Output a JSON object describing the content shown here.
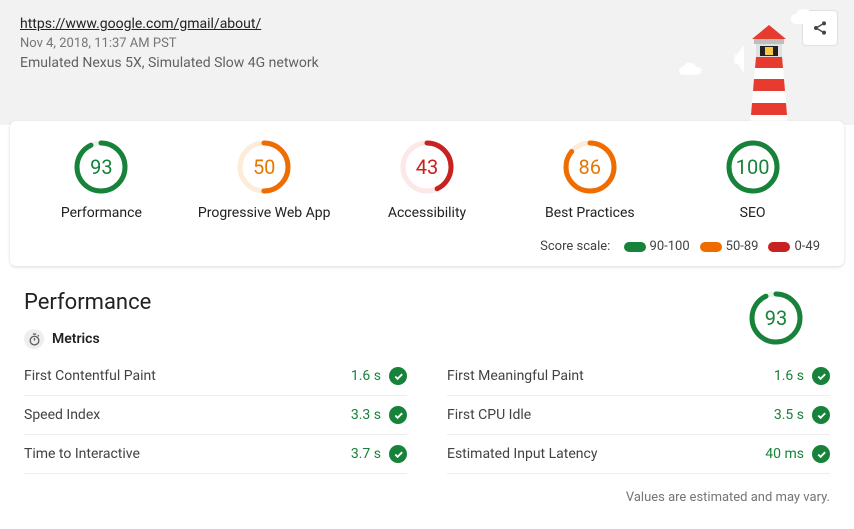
{
  "header": {
    "url": "https://www.google.com/gmail/about/",
    "timestamp": "Nov 4, 2018, 11:37 AM PST",
    "environment": "Emulated Nexus 5X, Simulated Slow 4G network"
  },
  "scores": [
    {
      "label": "Performance",
      "value": 93,
      "color": "#178239",
      "grade": "green"
    },
    {
      "label": "Progressive Web App",
      "value": 50,
      "color": "#ef6c00",
      "grade": "orange"
    },
    {
      "label": "Accessibility",
      "value": 43,
      "color": "#c7221f",
      "grade": "red"
    },
    {
      "label": "Best Practices",
      "value": 86,
      "color": "#ef6c00",
      "grade": "orange"
    },
    {
      "label": "SEO",
      "value": 100,
      "color": "#178239",
      "grade": "green"
    }
  ],
  "scale": {
    "label": "Score scale:",
    "ranges": [
      {
        "text": "90-100",
        "color": "#178239"
      },
      {
        "text": "50-89",
        "color": "#ef6c00"
      },
      {
        "text": "0-49",
        "color": "#c7221f"
      }
    ]
  },
  "performance": {
    "title": "Performance",
    "score": 93,
    "color": "#178239",
    "metrics_label": "Metrics",
    "metrics_left": [
      {
        "name": "First Contentful Paint",
        "value": "1.6 s"
      },
      {
        "name": "Speed Index",
        "value": "3.3 s"
      },
      {
        "name": "Time to Interactive",
        "value": "3.7 s"
      }
    ],
    "metrics_right": [
      {
        "name": "First Meaningful Paint",
        "value": "1.6 s"
      },
      {
        "name": "First CPU Idle",
        "value": "3.5 s"
      },
      {
        "name": "Estimated Input Latency",
        "value": "40 ms"
      }
    ],
    "footnote": "Values are estimated and may vary."
  }
}
